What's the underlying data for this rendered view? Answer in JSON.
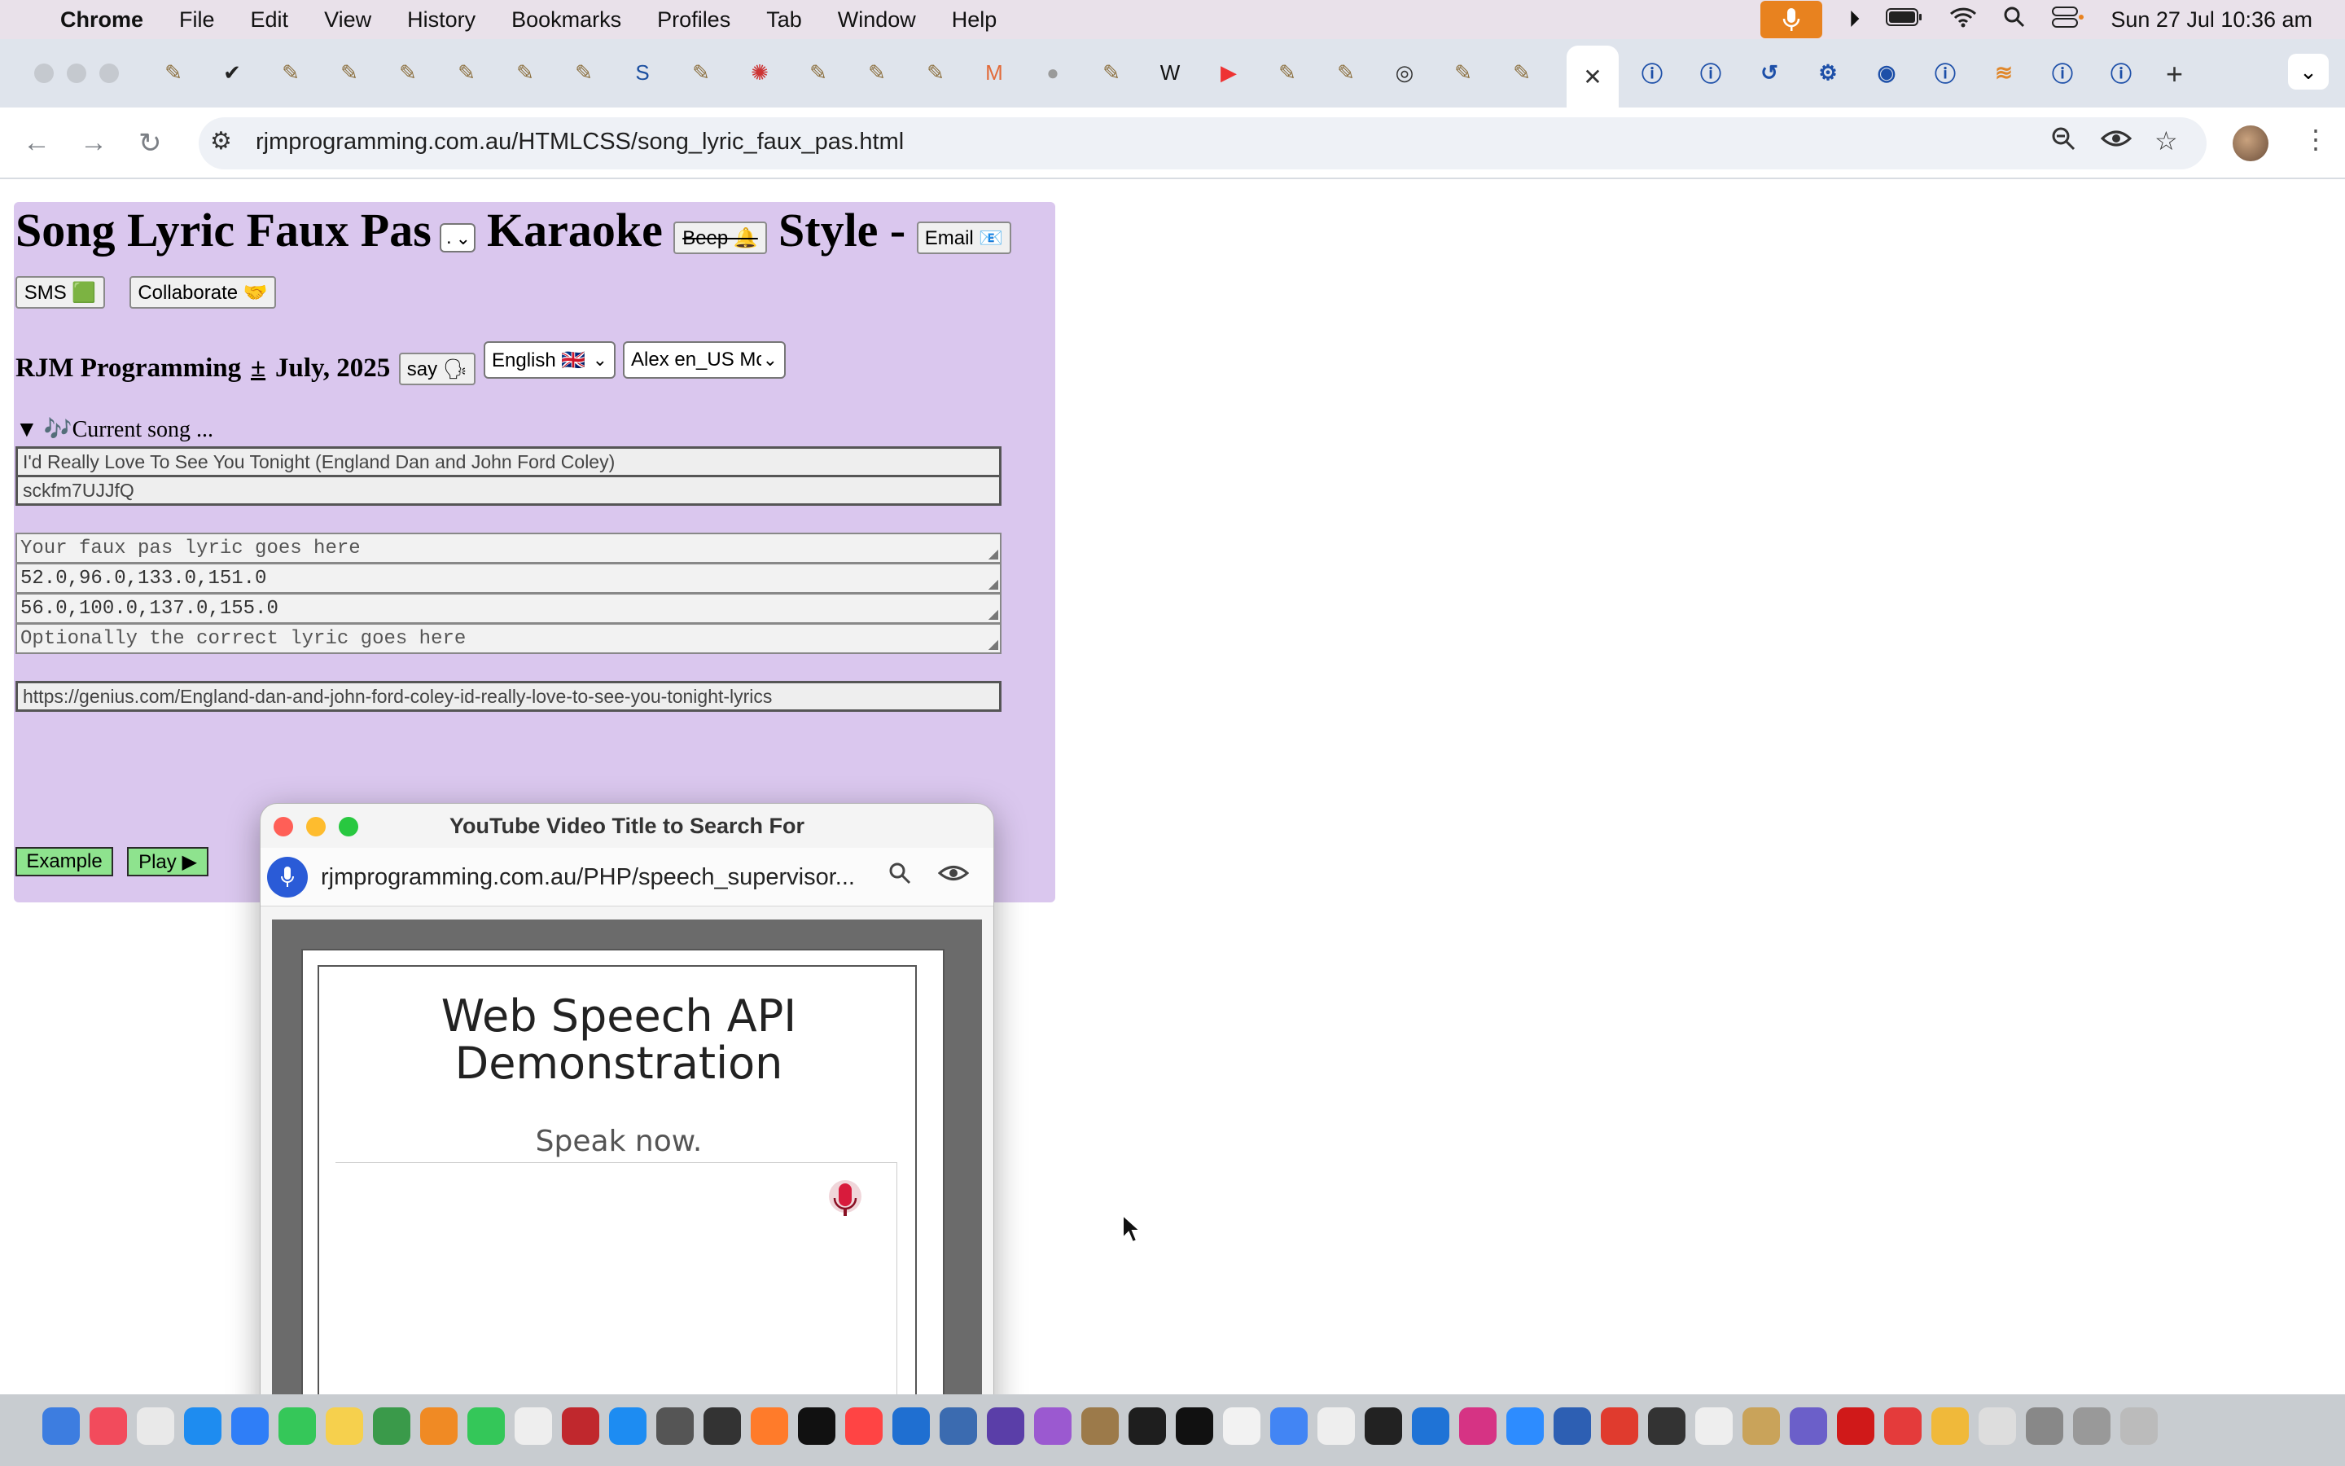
{
  "menubar": {
    "app_name": "Chrome",
    "items": [
      "File",
      "Edit",
      "View",
      "History",
      "Bookmarks",
      "Profiles",
      "Tab",
      "Window",
      "Help"
    ],
    "clock": "Sun 27 Jul  10:36 am"
  },
  "tabs": {
    "active_close": "✕",
    "new_tab": "+"
  },
  "browser": {
    "url": "rjmprogramming.com.au/HTMLCSS/song_lyric_faux_pas.html"
  },
  "page": {
    "title_part1": "Song Lyric Faux Pas",
    "title_select_value": ".",
    "title_part2": "Karaoke",
    "beep_label": "Beep 🔔",
    "title_part3": "Style -",
    "email_label": "Email 📧",
    "sms_label": "SMS 🟩",
    "collaborate_label": "Collaborate 🤝",
    "byline": "RJM Programming",
    "plusminus": "±",
    "date": "July, 2025",
    "say_label": "say 🗣",
    "language_value": "English 🇬🇧",
    "voice_value": "Alex en_US Mc",
    "details_summary": "▼ 🎶Current song ...",
    "song_title_value": "I'd Really Love To See You Tonight (England Dan and John Ford Coley)",
    "video_id_value": "sckfm7UJJfQ",
    "faux_pas_placeholder": "Your faux pas lyric goes here",
    "times_start": "52.0,96.0,133.0,151.0",
    "times_end": "56.0,100.0,137.0,155.0",
    "correct_placeholder": "Optionally the correct lyric goes here",
    "lyrics_url_value": "https://genius.com/England-dan-and-john-ford-coley-id-really-love-to-see-you-tonight-lyrics",
    "example_label": "Example",
    "play_label": "Play ▶"
  },
  "overlay": {
    "title": "YouTube Video Title to Search For",
    "url": "rjmprogramming.com.au/PHP/speech_supervisor...",
    "heading_line1": "Web Speech API",
    "heading_line2": "Demonstration",
    "speak_now": "Speak now."
  }
}
